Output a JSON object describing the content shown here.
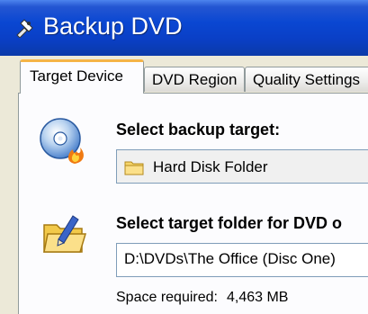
{
  "window": {
    "title": "Backup DVD"
  },
  "tabs": [
    {
      "label": "Target Device",
      "active": true
    },
    {
      "label": "DVD Region",
      "active": false
    },
    {
      "label": "Quality Settings",
      "active": false
    }
  ],
  "target": {
    "label": "Select backup target:",
    "selected": "Hard Disk Folder"
  },
  "folder": {
    "label": "Select target folder for DVD o",
    "value": "D:\\DVDs\\The Office (Disc One)"
  },
  "space": {
    "label": "Space required:",
    "value": "4,463 MB"
  },
  "colors": {
    "titlebar": "#0a47d2",
    "tab_highlight": "#f5b446",
    "dialog_bg": "#ece9d8"
  },
  "icons": [
    "dvd-tool-icon",
    "disc-burn-icon",
    "folder-icon",
    "folder-edit-icon"
  ]
}
